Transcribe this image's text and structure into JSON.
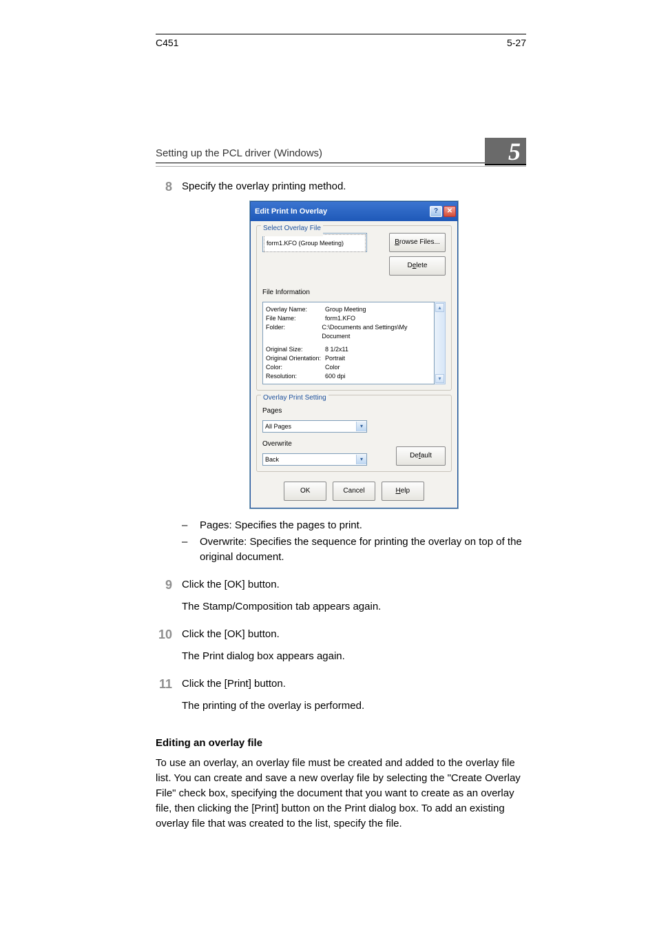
{
  "header": {
    "text": "Setting up the PCL driver (Windows)"
  },
  "chapter_number": "5",
  "steps": {
    "s8": {
      "num": "8",
      "text": "Specify the overlay printing method.",
      "bullets": [
        "Pages: Specifies the pages to print.",
        "Overwrite: Specifies the sequence for printing the overlay on top of the original document."
      ]
    },
    "s9": {
      "num": "9",
      "text": "Click the [OK] button.",
      "followup": "The Stamp/Composition tab appears again."
    },
    "s10": {
      "num": "10",
      "text": "Click the [OK] button.",
      "followup": "The Print dialog box appears again."
    },
    "s11": {
      "num": "11",
      "text": "Click the [Print] button.",
      "followup": "The printing of the overlay is performed."
    }
  },
  "section": {
    "heading": "Editing an overlay file",
    "para": "To use an overlay, an overlay file must be created and added to the overlay file list. You can create and save a new overlay file by selecting the \"Create Overlay File\" check box, specifying the document that you want to create as an overlay file, then clicking the [Print] button on the Print dialog box. To add an existing overlay file that was created to the list, specify the file."
  },
  "footer": {
    "left": "C451",
    "right": "5-27"
  },
  "dialog": {
    "title": "Edit Print In Overlay",
    "select_legend": "Select Overlay File",
    "file_item": "form1.KFO (Group Meeting)",
    "browse_btn": "Browse Files...",
    "browse_underline": "B",
    "delete_btn": "Delete",
    "delete_underline": "e",
    "info_heading": "File Information",
    "info": {
      "overlay_name_k": "Overlay Name:",
      "overlay_name_v": "Group Meeting",
      "file_name_k": "File Name:",
      "file_name_v": "form1.KFO",
      "folder_k": "Folder:",
      "folder_v": "C:\\Documents and Settings\\My Document",
      "orig_size_k": "Original Size:",
      "orig_size_v": "8 1/2x11",
      "orig_orient_k": "Original Orientation:",
      "orig_orient_v": "Portrait",
      "color_k": "Color:",
      "color_v": "Color",
      "resolution_k": "Resolution:",
      "resolution_v": "600 dpi"
    },
    "print_legend": "Overlay Print Setting",
    "pages_label": "Pages",
    "pages_value": "All Pages",
    "overwrite_label": "Overwrite",
    "overwrite_value": "Back",
    "default_btn": "Default",
    "default_underline": "f",
    "ok_btn": "OK",
    "cancel_btn": "Cancel",
    "help_btn": "Help",
    "help_underline": "H"
  }
}
